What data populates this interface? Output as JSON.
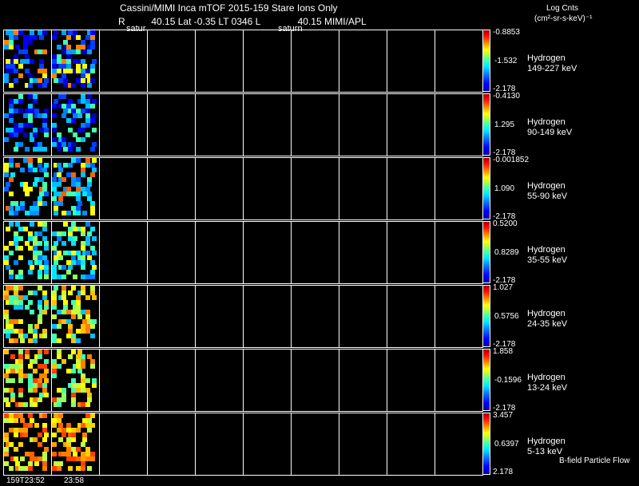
{
  "header": {
    "title": "Cassini/MIMI Inca mTOF  2015-159   Stare   Ions Only",
    "subtitle_r": "R",
    "subtitle_rest": "40.15 Lat -0.35 LT 0346 L",
    "subtitle_l_value": "40.15  MIMI/APL",
    "saturn_label_1": "satur",
    "saturn_label_2": "saturn"
  },
  "legend": {
    "title": "Log Cnts",
    "units": "(cm²-sr-s-keV)⁻¹",
    "flow_label": "B-field Particle Flow"
  },
  "colors": {
    "frame": "#ffffff",
    "background": "#000000"
  },
  "time_labels": [
    "159T23:52",
    "23:58"
  ],
  "panels": [
    {
      "species": "Hydrogen",
      "energy": "149-227 keV",
      "max": "-0.8853",
      "mid": "-1.532",
      "min": "-2.178"
    },
    {
      "species": "Hydrogen",
      "energy": "90-149 keV",
      "max": "-0.4130",
      "mid": "1.295",
      "min": "-2.178"
    },
    {
      "species": "Hydrogen",
      "energy": "55-90 keV",
      "max": "-0.001852",
      "mid": "1.090",
      "min": "-2.178"
    },
    {
      "species": "Hydrogen",
      "energy": "35-55 keV",
      "max": "0.5200",
      "mid": "0.8289",
      "min": "-2.178"
    },
    {
      "species": "Hydrogen",
      "energy": "24-35 keV",
      "max": "1.027",
      "mid": "0.5756",
      "min": "-2.178"
    },
    {
      "species": "Hydrogen",
      "energy": "13-24 keV",
      "max": "1.858",
      "mid": "-0.1596",
      "min": "-2.178"
    },
    {
      "species": "Hydrogen",
      "energy": "5-13 keV",
      "max": "3.457",
      "mid": "0.6397",
      "min": "2.178"
    }
  ]
}
